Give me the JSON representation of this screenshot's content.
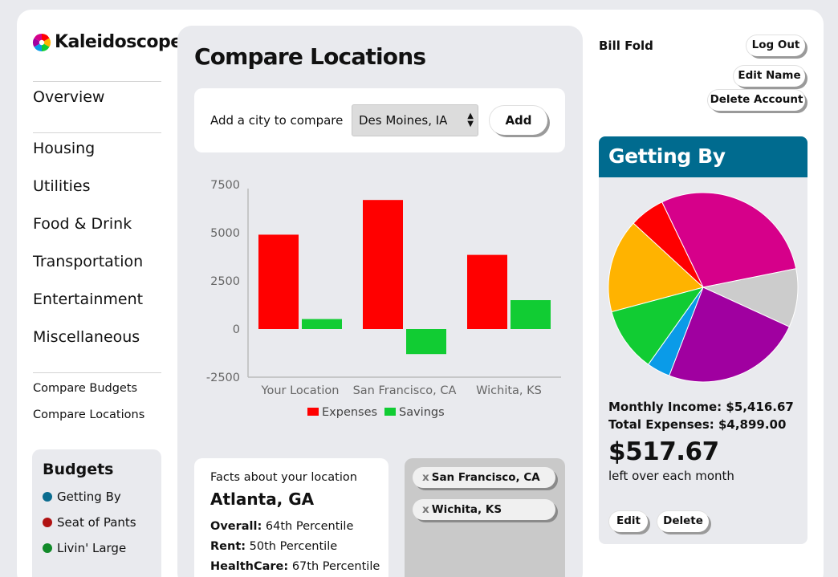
{
  "app": {
    "name": "Kaleidoscope"
  },
  "nav": {
    "main": [
      "Overview"
    ],
    "categories": [
      "Housing",
      "Utilities",
      "Food & Drink",
      "Transportation",
      "Entertainment",
      "Miscellaneous"
    ],
    "compare": [
      "Compare Budgets",
      "Compare Locations"
    ]
  },
  "budgets": {
    "title": "Budgets",
    "items": [
      {
        "label": "Getting By",
        "color": "#0b6c8f"
      },
      {
        "label": "Seat of Pants",
        "color": "#b01212"
      },
      {
        "label": "Livin' Large",
        "color": "#128a2a"
      }
    ]
  },
  "page": {
    "title": "Compare Locations"
  },
  "add_city": {
    "label": "Add a city to compare",
    "selected": "Des Moines, IA",
    "button": "Add"
  },
  "chart_data": {
    "type": "bar",
    "categories": [
      "Your Location",
      "San Francisco, CA",
      "Wichita, KS"
    ],
    "series": [
      {
        "name": "Expenses",
        "color": "#ff0000",
        "values": [
          4899,
          6700,
          3850
        ]
      },
      {
        "name": "Savings",
        "color": "#11cc33",
        "values": [
          517.67,
          -1300,
          1500
        ]
      }
    ],
    "ylim": [
      -2500,
      7500
    ],
    "yticks": [
      -2500,
      0,
      2500,
      5000,
      7500
    ],
    "legend": "bottom"
  },
  "facts": {
    "heading": "Facts about your location",
    "city": "Atlanta, GA",
    "items": [
      {
        "label": "Overall:",
        "value": "64th Percentile"
      },
      {
        "label": "Rent:",
        "value": "50th Percentile"
      },
      {
        "label": "HealthCare:",
        "value": "67th Percentile"
      }
    ]
  },
  "compared_cities": [
    "San Francisco, CA",
    "Wichita, KS"
  ],
  "remove_glyph": "x",
  "user": {
    "name": "Bill Fold",
    "logout": "Log Out",
    "edit_name": "Edit Name",
    "delete_account": "Delete Account"
  },
  "budget_card": {
    "title": "Getting By",
    "header_color": "#006b8f",
    "pie": [
      {
        "value": 29,
        "color": "#d6008a"
      },
      {
        "value": 10,
        "color": "#cccccc"
      },
      {
        "value": 24,
        "color": "#a000a0"
      },
      {
        "value": 4,
        "color": "#0a9be8"
      },
      {
        "value": 11,
        "color": "#11cc33"
      },
      {
        "value": 16,
        "color": "#ffb300"
      },
      {
        "value": 6,
        "color": "#ff0000"
      }
    ],
    "monthly_income": "Monthly Income: $5,416.67",
    "total_expenses": "Total Expenses: $4,899.00",
    "left_over": "$517.67",
    "left_over_label": "left over each month",
    "edit": "Edit",
    "delete": "Delete"
  }
}
